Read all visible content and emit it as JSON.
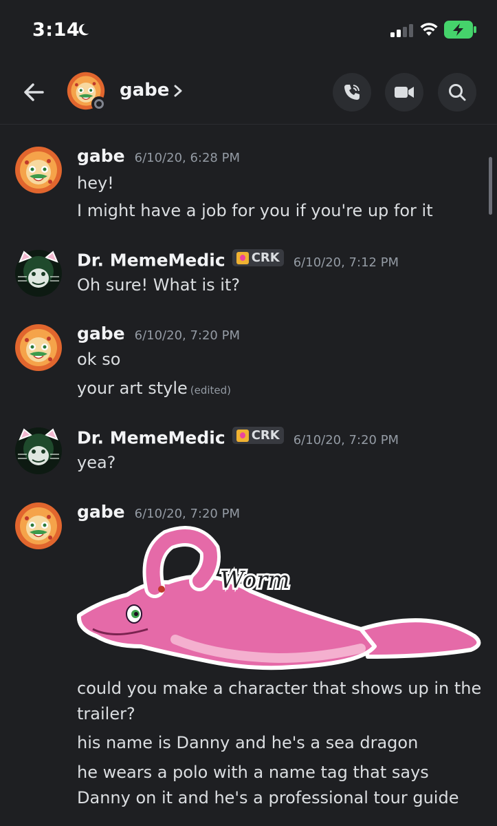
{
  "status_bar": {
    "time": "3:14"
  },
  "header": {
    "name": "gabe"
  },
  "messages": [
    {
      "author": "gabe",
      "timestamp": "6/10/20, 6:28 PM",
      "lines": [
        "hey!",
        "I might have a job for you if you're up for it"
      ]
    },
    {
      "author": "Dr. MemeMedic",
      "tag": "CRK",
      "timestamp": "6/10/20, 7:12 PM",
      "lines": [
        "Oh sure! What is it?"
      ]
    },
    {
      "author": "gabe",
      "timestamp": "6/10/20, 7:20 PM",
      "lines": [
        "ok so",
        "your art style"
      ],
      "edited": "(edited)"
    },
    {
      "author": "Dr. MemeMedic",
      "tag": "CRK",
      "timestamp": "6/10/20, 7:20 PM",
      "lines": [
        "yea?"
      ]
    },
    {
      "author": "gabe",
      "timestamp": "6/10/20, 7:20 PM",
      "image_caption": "Worm",
      "lines": [
        "could you make a character that shows up in the trailer?",
        "his name is Danny and he's a sea dragon",
        "he wears a polo with a name tag that says Danny on it and he's a professional tour guide"
      ]
    }
  ],
  "colors": {
    "background": "#1e1f22",
    "text": "#dbdee1",
    "muted": "#949ba4",
    "battery": "#45d36b"
  }
}
